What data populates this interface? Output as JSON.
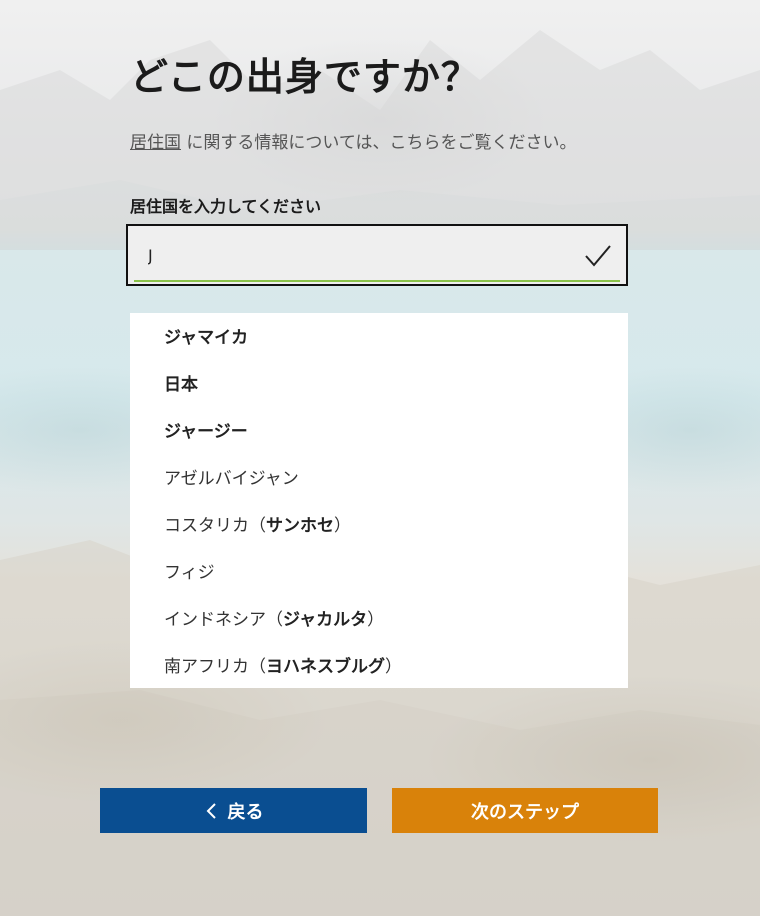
{
  "page": {
    "title": "どこの出身ですか？",
    "info_link": "居住国",
    "info_text": " に関する情報については、こちらをご覧ください。"
  },
  "form": {
    "label": "居住国を入力してください",
    "input_value": "J"
  },
  "suggestions": [
    {
      "plain": "",
      "bold": "ジャマイカ"
    },
    {
      "plain": "",
      "bold": "日本"
    },
    {
      "plain": "",
      "bold": "ジャージー"
    },
    {
      "plain": "アゼルバイジャン",
      "bold": ""
    },
    {
      "plain": "コスタリカ（",
      "bold": "サンホセ",
      "tail": "）"
    },
    {
      "plain": "フィジ",
      "bold": ""
    },
    {
      "plain": "インドネシア（",
      "bold": "ジャカルタ",
      "tail": "）"
    },
    {
      "plain": "南アフリカ（",
      "bold": "ヨハネスブルグ",
      "tail": "）"
    }
  ],
  "buttons": {
    "back": "戻る",
    "next": "次のステップ"
  },
  "colors": {
    "back_button": "#0a4e91",
    "next_button": "#d9820a",
    "input_underline": "#8bc34a"
  },
  "icons": {
    "input_valid": "checkmark-icon",
    "back": "chevron-left-icon"
  }
}
